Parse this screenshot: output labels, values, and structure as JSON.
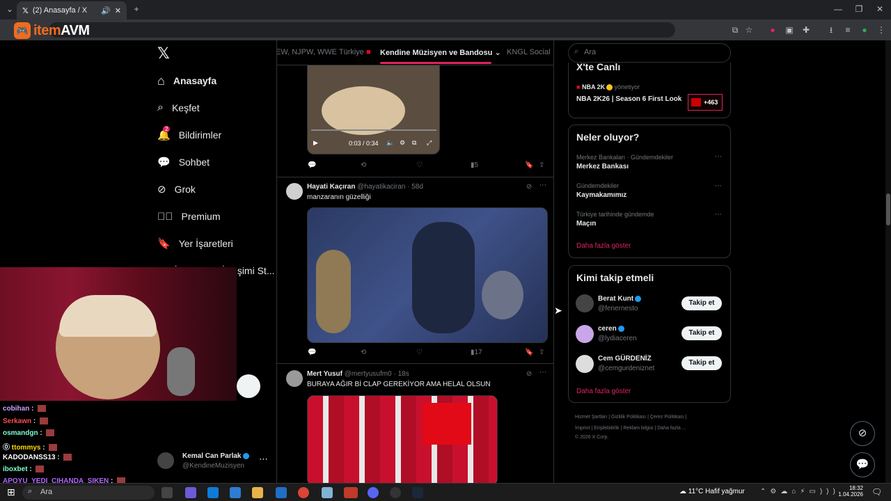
{
  "browser": {
    "tab_title": "(2) Anasayfa / X",
    "overlay_logo_prefix": "item",
    "overlay_logo_suffix": "AVM"
  },
  "nav": {
    "items": [
      {
        "label": "Anasayfa",
        "icon": "home-icon"
      },
      {
        "label": "Keşfet",
        "icon": "search-icon"
      },
      {
        "label": "Bildirimler",
        "icon": "bell-icon",
        "badge": "2"
      },
      {
        "label": "Sohbet",
        "icon": "chat-icon"
      },
      {
        "label": "Grok",
        "icon": "grok-icon"
      },
      {
        "label": "Premium",
        "icon": "premium-icon"
      },
      {
        "label": "Yer İşaretleri",
        "icon": "bookmark-icon"
      },
      {
        "label": "İş ilanları · İletişimi St...",
        "icon": "jobs-icon"
      }
    ],
    "profile_name": "Kemal Can Parlak",
    "profile_handle": "@KendineMuzisyen"
  },
  "topbar": {
    "tabs": [
      "EW, NJPW, WWE Türkiye",
      "Kendine Müzisyen ve Bandosu",
      "KNGL Social"
    ]
  },
  "tweets": [
    {
      "video_time": "0:03 / 0:34",
      "views": "5"
    },
    {
      "name": "Hayati Kaçıran",
      "handle": "@hayatikaciran",
      "time": "58d",
      "text": "manzaranın güzelliği",
      "views": "17"
    },
    {
      "name": "Mert Yusuf",
      "handle": "@mertyusufm0",
      "time": "18s",
      "text": "BURAYA AĞIR Bİ CLAP GEREKİYOR AMA HELAL OLSUN"
    }
  ],
  "right": {
    "search_placeholder": "Ara",
    "live": {
      "title": "X'te Canlı",
      "host": "NBA 2K",
      "host_role": "yönetiyor",
      "show": "NBA 2K26 | Season 6 First Look",
      "listeners": "+463"
    },
    "trends": {
      "title": "Neler oluyor?",
      "items": [
        {
          "context": "Merkez Bankaları · Gündemdekiler",
          "name": "Merkez Bankası"
        },
        {
          "context": "Gündemdekiler",
          "name": "Kaymakamımız"
        },
        {
          "context": "Türkiye tarihinde gündemde",
          "name": "Maçın"
        }
      ],
      "more": "Daha fazla göster"
    },
    "who_to_follow": {
      "title": "Kimi takip etmeli",
      "users": [
        {
          "name": "Berat Kunt",
          "handle": "@fenernesto",
          "button": "Takip et"
        },
        {
          "name": "ceren",
          "handle": "@lydiaceren",
          "button": "Takip et"
        },
        {
          "name": "Cem GÜRDENİZ",
          "handle": "@cemgurdeniznet",
          "button": "Takip et"
        }
      ],
      "more": "Daha fazla göster"
    },
    "footer": {
      "line1": "Hizmet Şartları  |  Gizlilik Politikası  |  Çerez Politikası  |",
      "line2": "İmprint  |  Erişilebilirlik  |  Reklam bilgisi  |  Daha fazla ...",
      "line3": "© 2026 X Corp."
    }
  },
  "chat": [
    {
      "user": "cobihan",
      "color": "#c9a0ff"
    },
    {
      "user": "Serkawn",
      "color": "#ff4d4d"
    },
    {
      "user": "osmandgn",
      "color": "#7fffd4"
    },
    {
      "user": "ttommys",
      "color": "#ffd700"
    },
    {
      "user": "KADODANSS13",
      "color": "#ffffff"
    },
    {
      "user": "iboxbet",
      "color": "#7fffd4"
    },
    {
      "user": "APOYU_YEDI_CIHANDA_SIKEN",
      "color": "#b266ff"
    }
  ],
  "taskbar": {
    "search": "Ara",
    "weather": "11°C  Hafif yağmur",
    "time": "18:32",
    "date": "1.04.2026"
  }
}
